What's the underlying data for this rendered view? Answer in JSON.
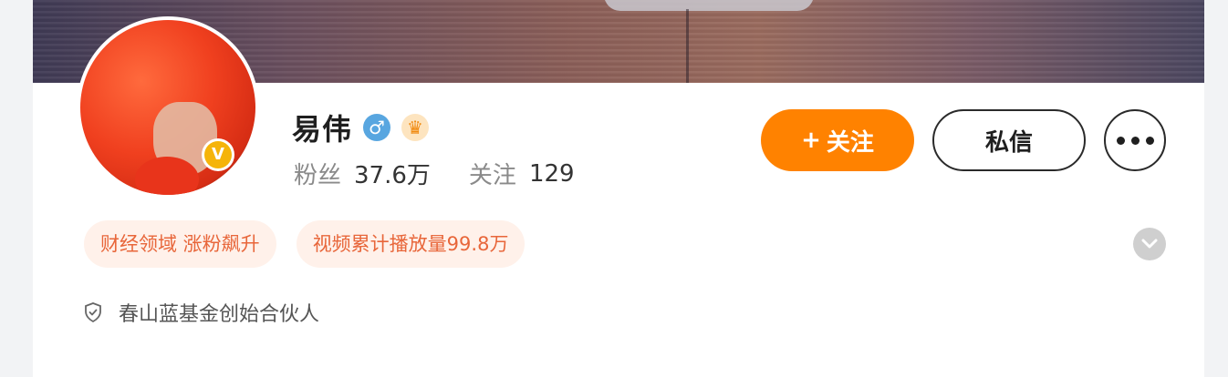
{
  "profile": {
    "name": "易伟",
    "verified_badge": "V",
    "gender_symbol": "♂",
    "crown_symbol": "♛",
    "stats": {
      "fans_label": "粉丝",
      "fans_value": "37.6万",
      "following_label": "关注",
      "following_value": "129"
    },
    "follow_button": {
      "plus": "+",
      "label": "关注"
    },
    "message_button_label": "私信",
    "tags": [
      "财经领域 涨粉飙升",
      "视频累计播放量99.8万"
    ],
    "description": "春山蓝基金创始合伙人"
  },
  "colors": {
    "accent_orange": "#ff8200",
    "verified_gold": "#f5b40a",
    "tag_text": "#e8663a",
    "tag_background": "#fff1ea"
  },
  "icons": [
    "verified-icon",
    "male-gender-icon",
    "crown-icon",
    "more-icon",
    "chevron-down-icon",
    "shield-icon"
  ]
}
